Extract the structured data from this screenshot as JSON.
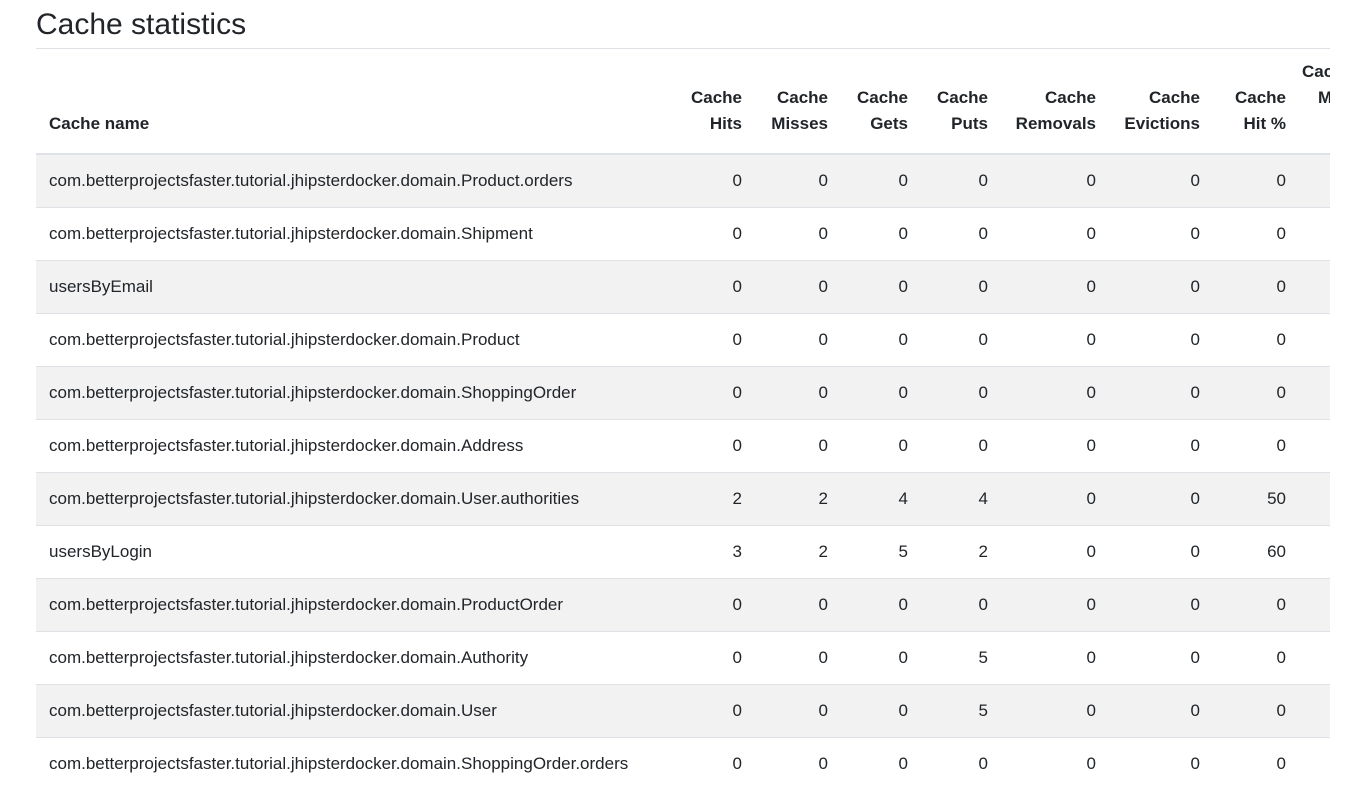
{
  "page": {
    "title": "Cache statistics"
  },
  "table": {
    "headers": {
      "name": "Cache name",
      "hits": [
        "Cache",
        "Hits"
      ],
      "misses": [
        "Cache",
        "Misses"
      ],
      "gets": [
        "Cache",
        "Gets"
      ],
      "puts": [
        "Cache",
        "Puts"
      ],
      "removals": [
        "Cache",
        "Removals"
      ],
      "evictions": [
        "Cache",
        "Evictions"
      ],
      "hit_pct": [
        "Cache",
        "Hit %"
      ],
      "truncated": [
        "Cac",
        "M"
      ]
    },
    "rows": [
      {
        "name": "com.betterprojectsfaster.tutorial.jhipsterdocker.domain.Product.orders",
        "hits": "0",
        "misses": "0",
        "gets": "0",
        "puts": "0",
        "removals": "0",
        "evictions": "0",
        "hit_pct": "0"
      },
      {
        "name": "com.betterprojectsfaster.tutorial.jhipsterdocker.domain.Shipment",
        "hits": "0",
        "misses": "0",
        "gets": "0",
        "puts": "0",
        "removals": "0",
        "evictions": "0",
        "hit_pct": "0"
      },
      {
        "name": "usersByEmail",
        "hits": "0",
        "misses": "0",
        "gets": "0",
        "puts": "0",
        "removals": "0",
        "evictions": "0",
        "hit_pct": "0"
      },
      {
        "name": "com.betterprojectsfaster.tutorial.jhipsterdocker.domain.Product",
        "hits": "0",
        "misses": "0",
        "gets": "0",
        "puts": "0",
        "removals": "0",
        "evictions": "0",
        "hit_pct": "0"
      },
      {
        "name": "com.betterprojectsfaster.tutorial.jhipsterdocker.domain.ShoppingOrder",
        "hits": "0",
        "misses": "0",
        "gets": "0",
        "puts": "0",
        "removals": "0",
        "evictions": "0",
        "hit_pct": "0"
      },
      {
        "name": "com.betterprojectsfaster.tutorial.jhipsterdocker.domain.Address",
        "hits": "0",
        "misses": "0",
        "gets": "0",
        "puts": "0",
        "removals": "0",
        "evictions": "0",
        "hit_pct": "0"
      },
      {
        "name": "com.betterprojectsfaster.tutorial.jhipsterdocker.domain.User.authorities",
        "hits": "2",
        "misses": "2",
        "gets": "4",
        "puts": "4",
        "removals": "0",
        "evictions": "0",
        "hit_pct": "50"
      },
      {
        "name": "usersByLogin",
        "hits": "3",
        "misses": "2",
        "gets": "5",
        "puts": "2",
        "removals": "0",
        "evictions": "0",
        "hit_pct": "60"
      },
      {
        "name": "com.betterprojectsfaster.tutorial.jhipsterdocker.domain.ProductOrder",
        "hits": "0",
        "misses": "0",
        "gets": "0",
        "puts": "0",
        "removals": "0",
        "evictions": "0",
        "hit_pct": "0"
      },
      {
        "name": "com.betterprojectsfaster.tutorial.jhipsterdocker.domain.Authority",
        "hits": "0",
        "misses": "0",
        "gets": "0",
        "puts": "5",
        "removals": "0",
        "evictions": "0",
        "hit_pct": "0"
      },
      {
        "name": "com.betterprojectsfaster.tutorial.jhipsterdocker.domain.User",
        "hits": "0",
        "misses": "0",
        "gets": "0",
        "puts": "5",
        "removals": "0",
        "evictions": "0",
        "hit_pct": "0"
      },
      {
        "name": "com.betterprojectsfaster.tutorial.jhipsterdocker.domain.ShoppingOrder.orders",
        "hits": "0",
        "misses": "0",
        "gets": "0",
        "puts": "0",
        "removals": "0",
        "evictions": "0",
        "hit_pct": "0"
      }
    ]
  },
  "colors": {
    "text": "#212529",
    "stripe": "#f2f2f2",
    "border": "#dee2e6"
  }
}
